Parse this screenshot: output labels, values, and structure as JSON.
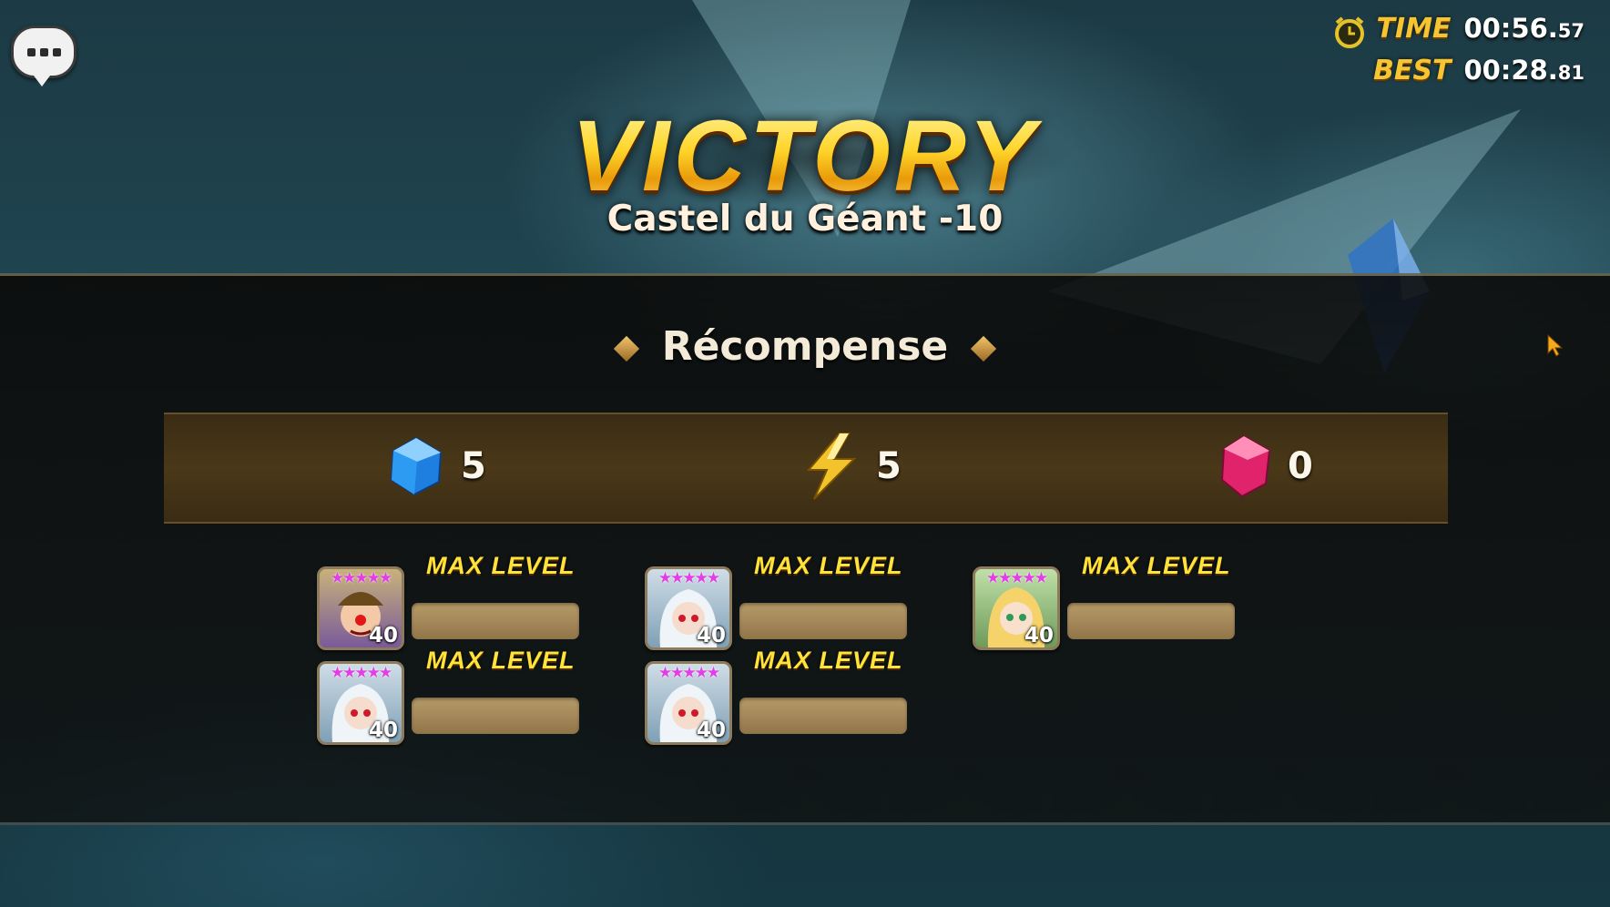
{
  "timer": {
    "time_label": "TIME",
    "time_main": "00:56.",
    "time_frac": "57",
    "best_label": "BEST",
    "best_main": "00:28.",
    "best_frac": "81"
  },
  "result": {
    "title": "VICTORY",
    "stage": "Castel du Géant -10"
  },
  "rewards": {
    "title": "Récompense",
    "currencies": [
      {
        "icon": "blue-crystal-icon",
        "amount": "5"
      },
      {
        "icon": "energy-bolt-icon",
        "amount": "5"
      },
      {
        "icon": "pink-crystal-icon",
        "amount": "0"
      }
    ]
  },
  "monsters": [
    {
      "status": "MAX LEVEL",
      "stars": "★★★★★",
      "level": "40",
      "portrait": "clown-monster-portrait",
      "xp_fill": 1.0
    },
    {
      "status": "MAX LEVEL",
      "stars": "★★★★★",
      "level": "40",
      "portrait": "white-hair-monster-portrait",
      "xp_fill": 1.0
    },
    {
      "status": "MAX LEVEL",
      "stars": "★★★★★",
      "level": "40",
      "portrait": "blonde-elf-monster-portrait",
      "xp_fill": 1.0
    },
    {
      "status": "MAX LEVEL",
      "stars": "★★★★★",
      "level": "40",
      "portrait": "white-hair-monster-portrait",
      "xp_fill": 1.0
    },
    {
      "status": "MAX LEVEL",
      "stars": "★★★★★",
      "level": "40",
      "portrait": "white-hair-monster-portrait",
      "xp_fill": 1.0
    }
  ],
  "colors": {
    "gold_text": "#ffd21c",
    "max_level": "#ffe23a",
    "star_pink": "#e23ee6",
    "xp_bar": "#a3875a"
  }
}
